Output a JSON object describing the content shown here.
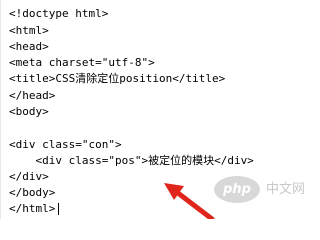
{
  "editor": {
    "lines": [
      "<!doctype html>",
      "<html>",
      "<head>",
      "<meta charset=\"utf-8\">",
      "<title>CSS清除定位position</title>",
      "</head>",
      "<body>",
      "",
      "<div class=\"con\">",
      "    <div class=\"pos\">被定位的模块</div>",
      "</div>",
      "</body>",
      "</html>"
    ]
  },
  "watermark": {
    "logo_text": "php",
    "site_text": "中文网"
  },
  "colors": {
    "arrow": "#e0261b",
    "text": "#000000",
    "watermark": "#c8c8c8"
  }
}
